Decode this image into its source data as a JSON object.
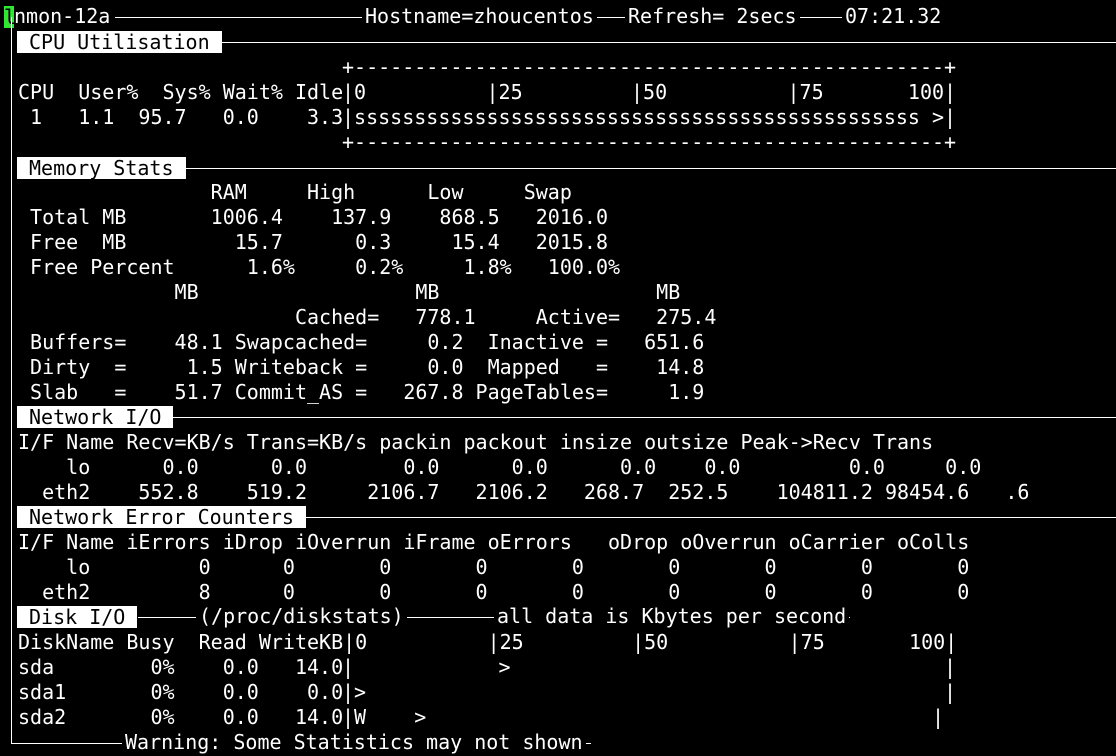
{
  "titlebar": {
    "cursor_char": "l",
    "program": "nmon-12a",
    "hostname": "Hostname=zhoucentos",
    "refresh": "Refresh= 2secs",
    "time": "07:21.32"
  },
  "cpu": {
    "title": "CPU Utilisation",
    "border": "+-------------------------------------------------+",
    "scale": "|0          |25         |50          |75       100|",
    "header": "CPU  User%  Sys% Wait% Idle",
    "rows": [
      {
        "stats": " 1   1.1  95.7   0.0    3.3",
        "bar": "|sssssssssssssssssssssssssssssssssssssssssssssss >|"
      }
    ]
  },
  "memory": {
    "title": "Memory Stats",
    "lines": [
      "                RAM     High      Low     Swap",
      " Total MB       1006.4    137.9    868.5   2016.0",
      " Free  MB         15.7      0.3     15.4   2015.8",
      " Free Percent      1.6%     0.2%     1.8%   100.0%",
      "             MB                  MB                  MB",
      "                       Cached=   778.1     Active=   275.4",
      " Buffers=    48.1 Swapcached=     0.2  Inactive =   651.6",
      " Dirty  =     1.5 Writeback =     0.0  Mapped   =    14.8",
      " Slab   =    51.7 Commit_AS =   267.8 PageTables=     1.9"
    ]
  },
  "network": {
    "title": "Network I/O",
    "lines": [
      "I/F Name Recv=KB/s Trans=KB/s packin packout insize outsize Peak->Recv Trans",
      "    lo      0.0      0.0        0.0      0.0      0.0    0.0         0.0     0.0",
      "  eth2    552.8    519.2     2106.7   2106.2   268.7  252.5    104811.2 98454.6   .6"
    ]
  },
  "neterrors": {
    "title": "Network Error Counters",
    "lines": [
      "I/F Name iErrors iDrop iOverrun iFrame oErrors   oDrop oOverrun oCarrier oColls",
      "    lo         0      0       0       0       0       0       0       0       0",
      "  eth2         8      0       0       0       0       0       0       0       0"
    ]
  },
  "disk": {
    "title": "Disk I/O",
    "source": "(/proc/diskstats)",
    "units_note": "all data is Kbytes per second",
    "header": "DiskName Busy  Read WriteKB|0          |25         |50          |75       100|",
    "rows": [
      {
        "stats": "sda        0%    0.0   14.0",
        "bar": "|            >                                    |"
      },
      {
        "stats": "sda1       0%    0.0    0.0",
        "bar": "|>                                                |"
      },
      {
        "stats": "sda2       0%    0.0   14.0",
        "bar": "|W    >                                          |"
      }
    ]
  },
  "footer": {
    "warning": "Warning: Some Statistics may not shown"
  }
}
